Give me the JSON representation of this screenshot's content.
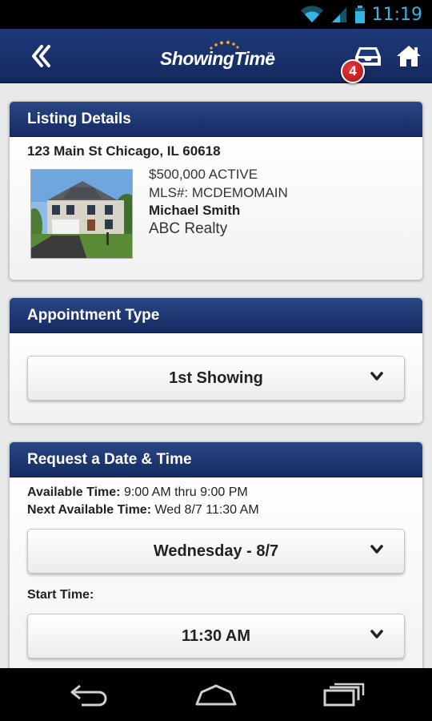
{
  "status_bar": {
    "time": "11:19",
    "icons": [
      "wifi-icon",
      "signal-icon",
      "battery-icon"
    ]
  },
  "app_bar": {
    "logo_text": "ShowingTime",
    "logo_tm": "™",
    "notification_count": "4",
    "icons": [
      "back-icon",
      "inbox-icon",
      "home-icon"
    ]
  },
  "listing": {
    "header": "Listing Details",
    "address": "123 Main St Chicago, IL 60618",
    "price_status": "$500,000 ACTIVE",
    "mls": "MLS#: MCDEMOMAIN",
    "agent": "Michael Smith",
    "office": "ABC Realty"
  },
  "appointment": {
    "header": "Appointment Type",
    "selected": "1st Showing"
  },
  "request": {
    "header": "Request a Date & Time",
    "available_label": "Available Time:",
    "available_value": "9:00 AM thru 9:00 PM",
    "next_label": "Next Available Time:",
    "next_value": "Wed 8/7 11:30 AM",
    "date_selected": "Wednesday - 8/7",
    "start_label": "Start Time:",
    "start_selected": "11:30 AM"
  },
  "nav_bar": {
    "icons": [
      "nav-back-icon",
      "nav-home-icon",
      "nav-recents-icon"
    ]
  },
  "colors": {
    "header_blue": "#1f3a7a",
    "badge_red": "#c8161b",
    "status_blue": "#33b5e5"
  }
}
